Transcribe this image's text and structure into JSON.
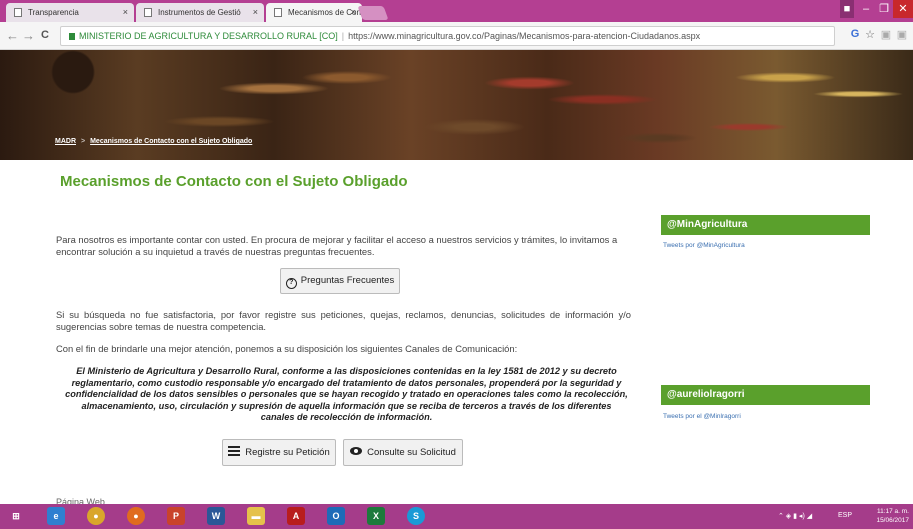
{
  "browser": {
    "tabs": [
      {
        "label": "Transparencia"
      },
      {
        "label": "Instrumentos de Gestió"
      },
      {
        "label": "Mecanismos de Contact"
      }
    ],
    "close_glyph": "×",
    "window_controls": {
      "user": "■",
      "minimize": "–",
      "maximize": "❐",
      "close": "✕"
    },
    "address": {
      "site_name": "MINISTERIO DE AGRICULTURA Y DESARROLLO RURAL [CO]",
      "url": "https://www.minagricultura.gov.co/Paginas/Mecanismos-para-atencion-Ciudadanos.aspx"
    },
    "nav": {
      "back": "←",
      "forward": "→",
      "reload": "C"
    },
    "toolbar_icons": [
      "translate-icon",
      "star-icon",
      "extension-icon",
      "extension-icon"
    ],
    "toolbar_glyphs": {
      "translate": "G",
      "star": "☆",
      "ext1": "▣",
      "ext2": "▣"
    }
  },
  "page": {
    "breadcrumb": {
      "root": "MADR",
      "separator": ">",
      "current": "Mecanismos de Contacto con el Sujeto Obligado"
    },
    "title": "Mecanismos de Contacto con el Sujeto Obligado",
    "intro": "Para nosotros es importante contar con usted. En procura de mejorar y facilitar el acceso a nuestros servicios y trámites, lo invitamos a encontrar solución a su inquietud a través de nuestras preguntas frecuentes.",
    "faq_button": "Preguntas Frecuentes",
    "faq_icon_glyph": "?",
    "register_text": "Si su búsqueda no fue satisfactoria, por favor registre sus peticiones, quejas, reclamos, denuncias, solicitudes de información y/o sugerencias sobre temas de nuestra competencia.",
    "channels_text": "Con el fin de brindarle una mejor atención, ponemos a su disposición los siguientes Canales de Comunicación:",
    "legal_text": "El Ministerio de Agricultura y Desarrollo Rural, conforme a las disposiciones contenidas en la ley 1581 de 2012 y su decreto reglamentario, como custodio responsable y/o encargado del tratamiento de datos personales, propenderá por la seguridad y confidencialidad de los datos sensibles o personales que se hayan recogido y tratado en operaciones tales como la recolección, almacenamiento, uso, circulación y supresión de aquella información que se reciba de terceros a través de los diferentes canales de recolección de información.",
    "register_button": "Registre su Petición",
    "consult_button": "Consulte su Solicitud",
    "footer_peek": "Página Web"
  },
  "sidebar": {
    "widget1": {
      "title": "@MinAgricultura",
      "subtitle": "Tweets por @MinAgricultura"
    },
    "widget2": {
      "title": "@aureliolragorri",
      "subtitle": "Tweets por el @Minlragorri"
    }
  },
  "taskbar": {
    "apps": [
      {
        "icon": "start-icon",
        "glyph": "⊞",
        "color": "#a53c8a"
      },
      {
        "icon": "ie-icon",
        "glyph": "e",
        "color": "#2f7fd0"
      },
      {
        "icon": "chrome-icon",
        "glyph": "●",
        "color": "#d9a62b"
      },
      {
        "icon": "firefox-icon",
        "glyph": "●",
        "color": "#e06b1f"
      },
      {
        "icon": "powerpoint-icon",
        "glyph": "P",
        "color": "#c9432b"
      },
      {
        "icon": "word-icon",
        "glyph": "W",
        "color": "#2b5797"
      },
      {
        "icon": "folder-icon",
        "glyph": "▬",
        "color": "#e5c14b"
      },
      {
        "icon": "acrobat-icon",
        "glyph": "A",
        "color": "#b81d1d"
      },
      {
        "icon": "outlook-icon",
        "glyph": "O",
        "color": "#1e6bb8"
      },
      {
        "icon": "excel-icon",
        "glyph": "X",
        "color": "#1d7a3c"
      },
      {
        "icon": "skype-icon",
        "glyph": "S",
        "color": "#1a9ad6"
      }
    ],
    "language": "ESP",
    "time": "11:17 a. m.",
    "date": "15/06/2017",
    "tray_glyphs": "⌃ ◈ ▮ ◂) ◢"
  }
}
